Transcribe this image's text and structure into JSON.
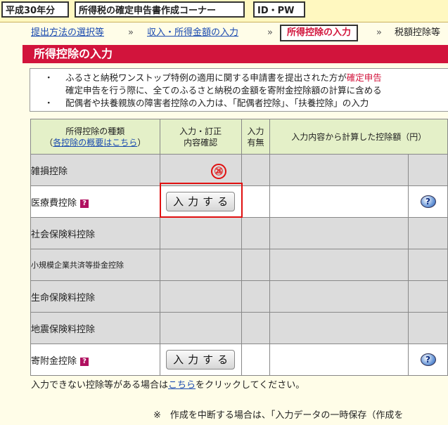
{
  "topbar": {
    "year": "平成30年分",
    "corner": "所得税の確定申告書作成コーナー",
    "idpw": "ID・PW"
  },
  "breadcrumb": {
    "step1": "提出方法の選択等",
    "step2": "収入・所得金額の入力",
    "step3": "所得控除の入力",
    "step4": "税額控除等",
    "sep": "»"
  },
  "section_title": "所得控除の入力",
  "notice": {
    "bullet": "・",
    "line1_a": "ふるさと納税ワンストップ特例の適用に関する申請書を提出された方が",
    "line1_b": "確定申告",
    "line2": "確定申告を行う際に、全てのふるさと納税の金額を寄附金控除額の計算に含める",
    "line3": "配偶者や扶養親族の障害者控除の入力は、「配偶者控除」、「扶養控除」の入力"
  },
  "table": {
    "header": {
      "col1_line1": "所得控除の種類",
      "col1_link": "各控除の概要はこちら",
      "col1_paren_open": "（",
      "col1_paren_close": "）",
      "col2_line1": "入力・訂正",
      "col2_line2": "内容確認",
      "col3_line1": "入力",
      "col3_line2": "有無",
      "col4": "入力内容から計算した控除額（円）"
    },
    "rows": [
      {
        "label": "雑損控除"
      },
      {
        "label": "医療費控除",
        "button": "入力する"
      },
      {
        "label": "社会保険料控除"
      },
      {
        "label": "小規模企業共済等掛金控除"
      },
      {
        "label": "生命保険料控除"
      },
      {
        "label": "地震保険料控除"
      },
      {
        "label": "寄附金控除",
        "button": "入力する"
      }
    ],
    "help_glyph": "?",
    "qicon_glyph": "?"
  },
  "marker": "㉖",
  "footer": {
    "line1_a": "入力できない控除等がある場合は",
    "line1_link": "こちら",
    "line1_b": "をクリックしてください。",
    "line2": "※　作成を中断する場合は、「入力データの一時保存（作成を"
  },
  "colors": {
    "accent": "#d2143c",
    "header_bg": "#e4f0c8",
    "page_bg": "#fffde8",
    "highlight": "#e01010"
  }
}
